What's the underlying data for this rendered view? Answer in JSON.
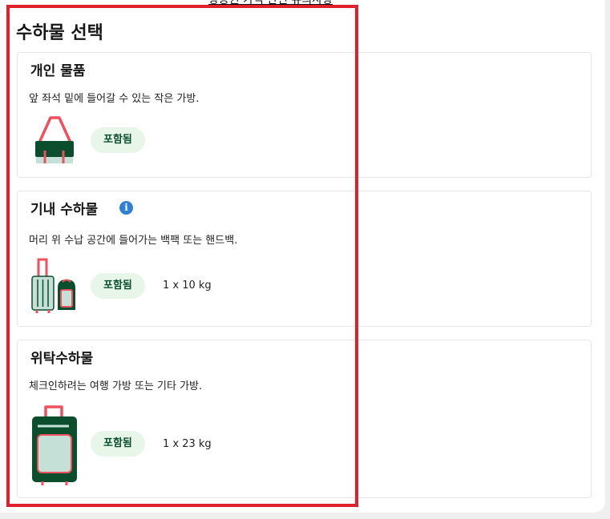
{
  "header": {
    "top_link": "항공권 가격 관련 유의사항",
    "chevron": "›"
  },
  "section": {
    "title": "수하물 선택"
  },
  "cards": [
    {
      "title": "개인 물품",
      "description": "앞 좌석 밑에 들어갈 수 있는 작은 가방.",
      "badge": "포함됨",
      "weight": ""
    },
    {
      "title": "기내 수하물",
      "description": "머리 위 수납 공간에 들어가는 백팩 또는 핸드백.",
      "badge": "포함됨",
      "weight": "1 x 10 kg"
    },
    {
      "title": "위탁수하물",
      "description": "체크인하려는 여행 가방 또는 기타 가방.",
      "badge": "포함됨",
      "weight": "1 x 23 kg"
    }
  ],
  "icons": {
    "info": "i"
  },
  "colors": {
    "accent_green": "#0b4e2e",
    "badge_bg": "#e7f6e9",
    "highlight": "#e0202b",
    "info": "#2f80d4",
    "bag_red": "#f0505e"
  }
}
